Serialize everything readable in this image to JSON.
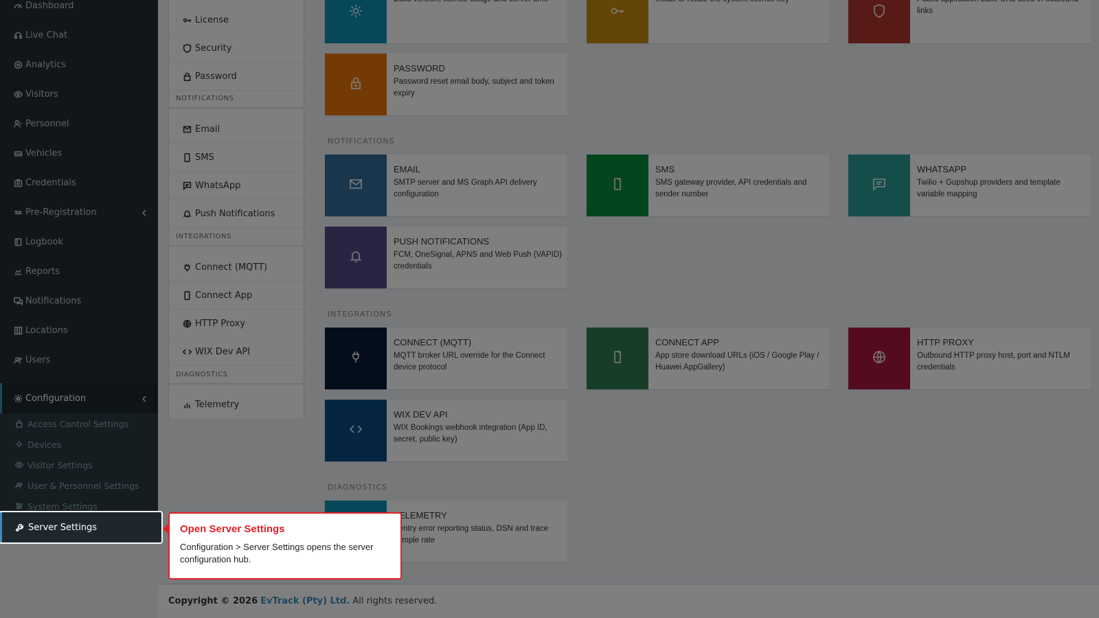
{
  "sidebar": {
    "items": [
      {
        "label": "Dashboard",
        "icon": "dashboard-icon"
      },
      {
        "label": "Live Chat",
        "icon": "headset-icon"
      },
      {
        "label": "Analytics",
        "icon": "target-icon"
      },
      {
        "label": "Visitors",
        "icon": "eye-icon"
      },
      {
        "label": "Personnel",
        "icon": "user-icon"
      },
      {
        "label": "Vehicles",
        "icon": "car-icon"
      },
      {
        "label": "Credentials",
        "icon": "id-card-icon"
      },
      {
        "label": "Pre-Registration",
        "icon": "arrows-icon"
      },
      {
        "label": "Logbook",
        "icon": "book-icon"
      },
      {
        "label": "Reports",
        "icon": "chart-icon"
      },
      {
        "label": "Notifications",
        "icon": "chat-icon"
      },
      {
        "label": "Locations",
        "icon": "building-icon"
      },
      {
        "label": "Users",
        "icon": "users-icon"
      },
      {
        "label": "Configuration",
        "icon": "gear-icon"
      }
    ],
    "submenu": [
      {
        "label": "Access Control Settings",
        "icon": "lock-icon"
      },
      {
        "label": "Devices",
        "icon": "chip-icon"
      },
      {
        "label": "Visitor Settings",
        "icon": "eye-icon"
      },
      {
        "label": "User & Personnel Settings",
        "icon": "users-icon"
      },
      {
        "label": "System Settings",
        "icon": "sliders-icon"
      },
      {
        "label": "Server Settings",
        "icon": "wrench-icon"
      }
    ]
  },
  "midnav": {
    "items": [
      {
        "label": "License",
        "icon": "key-icon"
      },
      {
        "label": "Security",
        "icon": "shield-icon"
      },
      {
        "label": "Password",
        "icon": "lock-icon"
      },
      {
        "label": "Email",
        "icon": "mail-icon"
      },
      {
        "label": "SMS",
        "icon": "phone-icon"
      },
      {
        "label": "WhatsApp",
        "icon": "message-icon"
      },
      {
        "label": "Push Notifications",
        "icon": "bell-icon"
      },
      {
        "label": "Connect (MQTT)",
        "icon": "plug-icon"
      },
      {
        "label": "Connect App",
        "icon": "phone-icon"
      },
      {
        "label": "HTTP Proxy",
        "icon": "globe-icon"
      },
      {
        "label": "WIX Dev API",
        "icon": "code-icon"
      },
      {
        "label": "Telemetry",
        "icon": "bar-chart-icon"
      }
    ],
    "headers": [
      "NOTIFICATIONS",
      "INTEGRATIONS",
      "DIAGNOSTICS"
    ]
  },
  "sections": {
    "notifications": "NOTIFICATIONS",
    "integrations": "INTEGRATIONS",
    "diagnostics": "DIAGNOSTICS"
  },
  "cards": [
    {
      "title": "",
      "desc": "Build version, license usage and server time",
      "color": "#0c8fb5",
      "icon": "gear-icon"
    },
    {
      "title": "",
      "desc": "Install or rotate the system licence key",
      "color": "#c98a10",
      "icon": "key-icon"
    },
    {
      "title": "",
      "desc": "Public application base URL used in outbound links",
      "color": "#b0352c",
      "icon": "shield-icon"
    },
    {
      "title": "PASSWORD",
      "desc": "Password reset email body, subject and token expiry",
      "color": "#e8750d",
      "icon": "lock-icon"
    },
    {
      "title": "EMAIL",
      "desc": "SMTP server and MS Graph API delivery configuration",
      "color": "#346d9b",
      "icon": "mail-icon"
    },
    {
      "title": "SMS",
      "desc": "SMS gateway provider, API credentials and sender number",
      "color": "#088a3c",
      "icon": "phone-icon"
    },
    {
      "title": "WHATSAPP",
      "desc": "Twilio + Gupshup providers and template variable mapping",
      "color": "#2b9a97",
      "icon": "message-icon"
    },
    {
      "title": "PUSH NOTIFICATIONS",
      "desc": "FCM, OneSignal, APNS and Web Push (VAPID) credentials",
      "color": "#514a87",
      "icon": "bell-icon"
    },
    {
      "title": "CONNECT (MQTT)",
      "desc": "MQTT broker URL override for the Connect device protocol",
      "color": "#061a36",
      "icon": "plug-icon"
    },
    {
      "title": "CONNECT APP",
      "desc": "App store download URLs (iOS / Google Play / Huawei AppGallery)",
      "color": "#2f7a53",
      "icon": "phone-icon"
    },
    {
      "title": "HTTP PROXY",
      "desc": "Outbound HTTP proxy host, port and NTLM credentials",
      "color": "#a9173e",
      "icon": "globe-icon"
    },
    {
      "title": "WIX DEV API",
      "desc": "WIX Bookings webhook integration (App ID, secret, public key)",
      "color": "#0b4a87",
      "icon": "code-icon"
    },
    {
      "title": "TELEMETRY",
      "desc": "Sentry error reporting status, DSN and trace sample rate",
      "color": "#0c8fb5",
      "icon": "bar-chart-icon"
    }
  ],
  "footer": {
    "prefix": "Copyright © 2026",
    "company": "EvTrack (Pty) Ltd.",
    "suffix": "All rights reserved."
  },
  "tooltip": {
    "title": "Open Server Settings",
    "body": "Configuration > Server Settings opens the server configuration hub."
  }
}
